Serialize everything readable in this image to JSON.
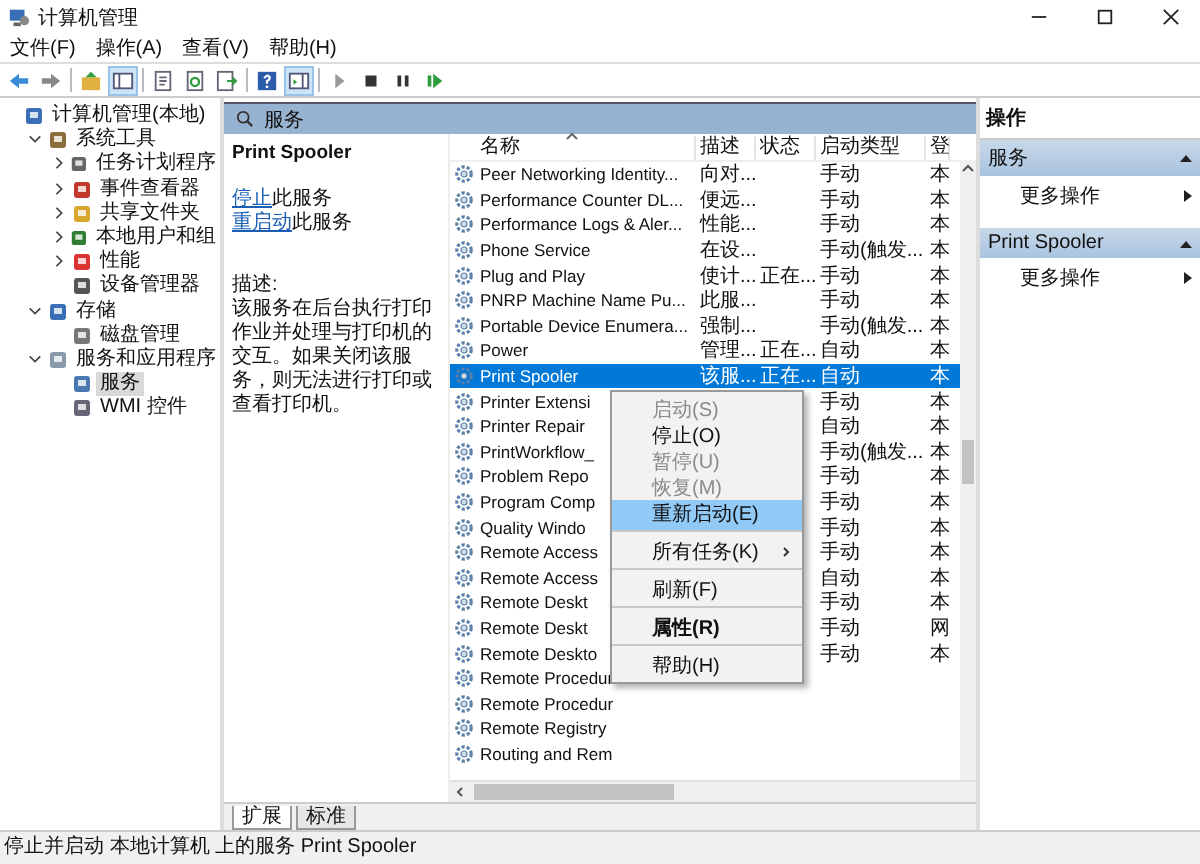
{
  "window": {
    "title": "计算机管理"
  },
  "menu": [
    "文件(F)",
    "操作(A)",
    "查看(V)",
    "帮助(H)"
  ],
  "tree": [
    {
      "label": "计算机管理(本地)",
      "kind": "computer",
      "selected": false,
      "children": [
        {
          "label": "系统工具",
          "kind": "tools",
          "selected": false,
          "expanded": true,
          "children": [
            {
              "label": "任务计划程序",
              "kind": "clock",
              "selected": false,
              "expanded": false
            },
            {
              "label": "事件查看器",
              "kind": "log",
              "selected": false,
              "expanded": false
            },
            {
              "label": "共享文件夹",
              "kind": "folder",
              "selected": false,
              "expanded": false
            },
            {
              "label": "本地用户和组",
              "kind": "users",
              "selected": false,
              "expanded": false
            },
            {
              "label": "性能",
              "kind": "perf",
              "selected": false,
              "expanded": false
            },
            {
              "label": "设备管理器",
              "kind": "device",
              "selected": false
            }
          ]
        },
        {
          "label": "存储",
          "kind": "storage",
          "selected": false,
          "expanded": true,
          "children": [
            {
              "label": "磁盘管理",
              "kind": "disk",
              "selected": false
            }
          ]
        },
        {
          "label": "服务和应用程序",
          "kind": "apps",
          "selected": false,
          "expanded": true,
          "children": [
            {
              "label": "服务",
              "kind": "service",
              "selected": true
            },
            {
              "label": "WMI 控件",
              "kind": "wmi",
              "selected": false
            }
          ]
        }
      ]
    }
  ],
  "panel_title": "服务",
  "details": {
    "title": "Print Spooler",
    "actions": [
      {
        "link": "停止",
        "rest": "此服务"
      },
      {
        "link": "重启动",
        "rest": "此服务"
      }
    ],
    "description_label": "描述:",
    "description": "该服务在后台执行打印作业并处理与打印机的交互。如果关闭该服务，则无法进行打印或查看打印机。"
  },
  "table": {
    "columns": [
      "名称",
      "描述",
      "状态",
      "启动类型",
      "登"
    ],
    "rows": [
      {
        "cells": [
          "Peer Networking Identity...",
          "向对...",
          "",
          "手动",
          "本"
        ],
        "selected": false
      },
      {
        "cells": [
          "Performance Counter DL...",
          "便远...",
          "",
          "手动",
          "本"
        ],
        "selected": false
      },
      {
        "cells": [
          "Performance Logs & Aler...",
          "性能...",
          "",
          "手动",
          "本"
        ],
        "selected": false
      },
      {
        "cells": [
          "Phone Service",
          "在设...",
          "",
          "手动(触发...",
          "本"
        ],
        "selected": false
      },
      {
        "cells": [
          "Plug and Play",
          "使计...",
          "正在...",
          "手动",
          "本"
        ],
        "selected": false
      },
      {
        "cells": [
          "PNRP Machine Name Pu...",
          "此服...",
          "",
          "手动",
          "本"
        ],
        "selected": false
      },
      {
        "cells": [
          "Portable Device Enumera...",
          "强制...",
          "",
          "手动(触发...",
          "本"
        ],
        "selected": false
      },
      {
        "cells": [
          "Power",
          "管理...",
          "正在...",
          "自动",
          "本"
        ],
        "selected": false
      },
      {
        "cells": [
          "Print Spooler",
          "该服...",
          "正在...",
          "自动",
          "本"
        ],
        "selected": true
      },
      {
        "cells": [
          "Printer Extensi",
          "",
          "",
          "手动",
          "本"
        ],
        "selected": false
      },
      {
        "cells": [
          "Printer Repair",
          "",
          "",
          "自动",
          "本"
        ],
        "selected": false
      },
      {
        "cells": [
          "PrintWorkflow_",
          "",
          "",
          "手动(触发...",
          "本"
        ],
        "selected": false
      },
      {
        "cells": [
          "Problem Repo",
          "",
          "",
          "手动",
          "本"
        ],
        "selected": false
      },
      {
        "cells": [
          "Program Comp",
          "",
          "",
          "手动",
          "本"
        ],
        "selected": false
      },
      {
        "cells": [
          "Quality Windo",
          "",
          "",
          "手动",
          "本"
        ],
        "selected": false
      },
      {
        "cells": [
          "Remote Access",
          "",
          "",
          "手动",
          "本"
        ],
        "selected": false
      },
      {
        "cells": [
          "Remote Access",
          "",
          "",
          "自动",
          "本"
        ],
        "selected": false
      },
      {
        "cells": [
          "Remote Deskt",
          "",
          "",
          "手动",
          "本"
        ],
        "selected": false
      },
      {
        "cells": [
          "Remote Deskt",
          "",
          "",
          "手动",
          "网"
        ],
        "selected": false
      },
      {
        "cells": [
          "Remote Deskto",
          "",
          "",
          "手动",
          "本"
        ],
        "selected": false
      },
      {
        "cells": [
          "Remote Procedur",
          "",
          "",
          "",
          ""
        ],
        "selected": false
      },
      {
        "cells": [
          "Remote Procedur",
          "",
          "",
          "",
          ""
        ],
        "selected": false
      },
      {
        "cells": [
          "Remote Registry",
          "",
          "",
          "",
          ""
        ],
        "selected": false
      },
      {
        "cells": [
          "Routing and Rem",
          "",
          "",
          "",
          ""
        ],
        "selected": false
      }
    ]
  },
  "context_menu": [
    {
      "label": "启动(S)",
      "disabled": true,
      "selected": false,
      "bold": false,
      "submenu": false,
      "separator_after": false
    },
    {
      "label": "停止(O)",
      "disabled": false,
      "selected": false,
      "bold": false,
      "submenu": false,
      "separator_after": false
    },
    {
      "label": "暂停(U)",
      "disabled": true,
      "selected": false,
      "bold": false,
      "submenu": false,
      "separator_after": false
    },
    {
      "label": "恢复(M)",
      "disabled": true,
      "selected": false,
      "bold": false,
      "submenu": false,
      "separator_after": false
    },
    {
      "label": "重新启动(E)",
      "disabled": false,
      "selected": true,
      "bold": false,
      "submenu": false,
      "separator_after": true
    },
    {
      "label": "所有任务(K)",
      "disabled": false,
      "selected": false,
      "bold": false,
      "submenu": true,
      "separator_after": true
    },
    {
      "label": "刷新(F)",
      "disabled": false,
      "selected": false,
      "bold": false,
      "submenu": false,
      "separator_after": true
    },
    {
      "label": "属性(R)",
      "disabled": false,
      "selected": false,
      "bold": true,
      "submenu": false,
      "separator_after": true
    },
    {
      "label": "帮助(H)",
      "disabled": false,
      "selected": false,
      "bold": false,
      "submenu": false,
      "separator_after": false
    }
  ],
  "view_tabs": [
    {
      "label": "扩展",
      "selected": true
    },
    {
      "label": "标准",
      "selected": false
    }
  ],
  "actions_pane": {
    "title": "操作",
    "sections": [
      {
        "title": "服务",
        "items": [
          "更多操作"
        ]
      },
      {
        "title": "Print Spooler",
        "items": [
          "更多操作"
        ]
      }
    ]
  },
  "status_bar": "停止并启动 本地计算机 上的服务 Print Spooler"
}
